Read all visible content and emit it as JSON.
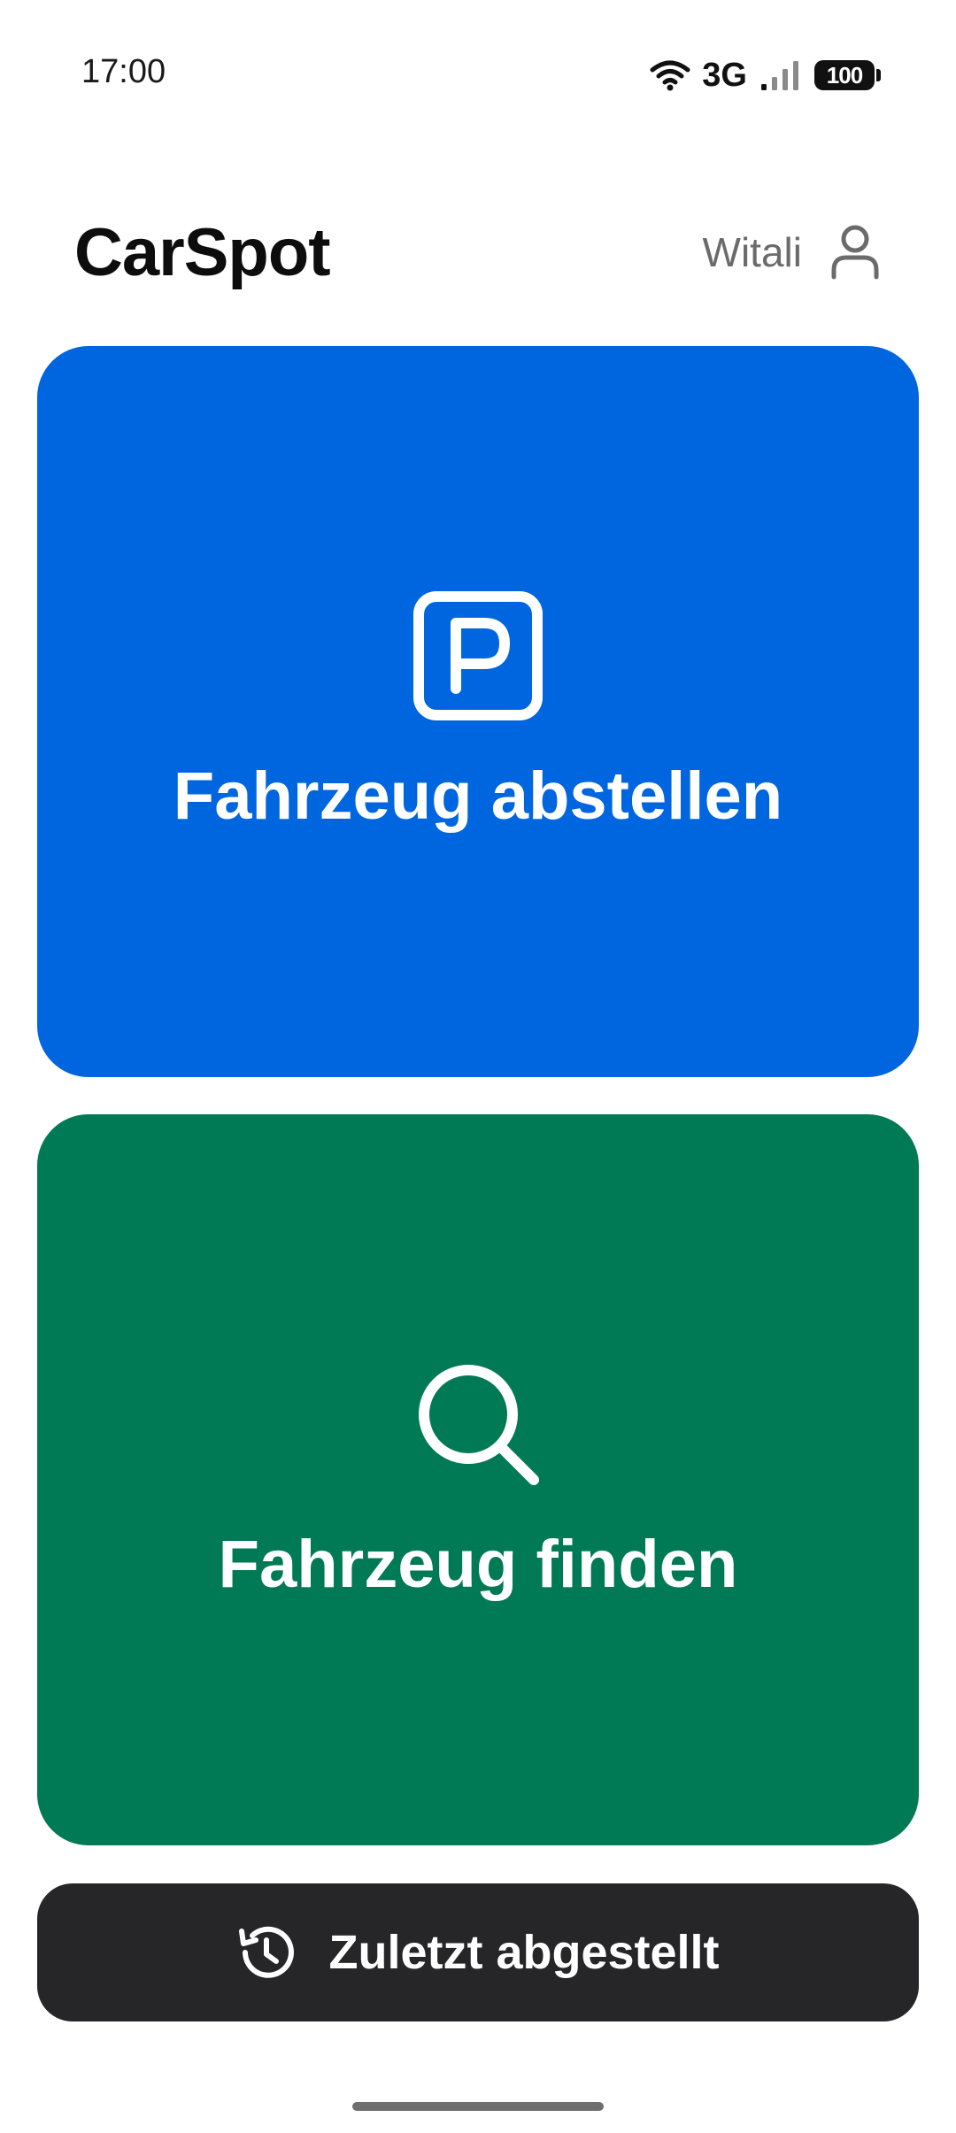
{
  "status_bar": {
    "time": "17:00",
    "network": "3G",
    "battery": "100",
    "icons": [
      "wifi-icon",
      "signal-icon",
      "battery-icon"
    ]
  },
  "header": {
    "title": "CarSpot",
    "user_name": "Witali",
    "user_icon": "person-icon"
  },
  "actions": {
    "park": {
      "label": "Fahrzeug abstellen",
      "icon": "parking-icon",
      "color": "#0066df"
    },
    "find": {
      "label": "Fahrzeug finden",
      "icon": "search-icon",
      "color": "#007a55"
    }
  },
  "recent": {
    "label": "Zuletzt abgestellt",
    "icon": "history-icon",
    "color": "#262628"
  }
}
